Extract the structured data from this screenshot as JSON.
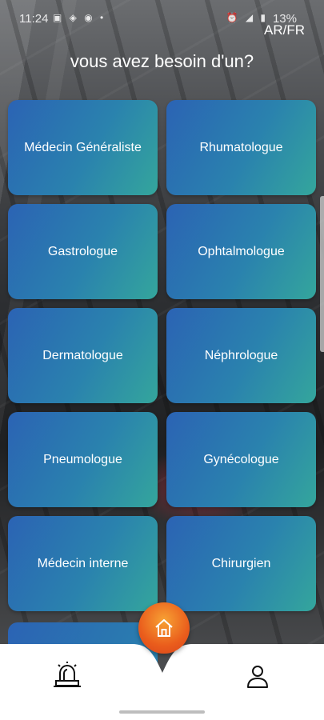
{
  "status_bar": {
    "time": "11:24",
    "battery": "13%"
  },
  "header": {
    "lang_toggle": "AR/FR",
    "title": "vous avez besoin d'un?"
  },
  "specialties": [
    {
      "label": "Médecin Généraliste"
    },
    {
      "label": "Rhumatologue"
    },
    {
      "label": "Gastrologue"
    },
    {
      "label": "Ophtalmologue"
    },
    {
      "label": "Dermatologue"
    },
    {
      "label": "Néphrologue"
    },
    {
      "label": "Pneumologue"
    },
    {
      "label": "Gynécologue"
    },
    {
      "label": "Médecin interne"
    },
    {
      "label": "Chirurgien"
    }
  ],
  "bottom_nav": {
    "left_icon": "emergency-siren-icon",
    "center_icon": "home-icon",
    "right_icon": "user-profile-icon"
  },
  "colors": {
    "card_gradient_start": "#2b63b4",
    "card_gradient_end": "#34a69c",
    "fab_orange": "#ea5d1c"
  }
}
